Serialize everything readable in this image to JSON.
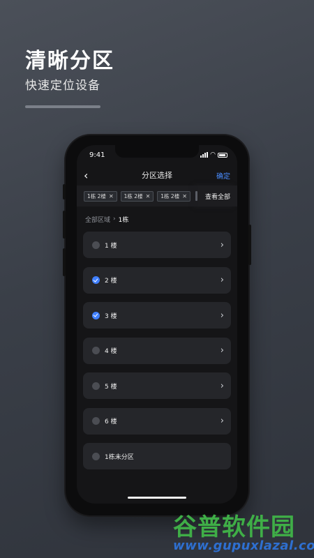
{
  "promo": {
    "title": "清晰分区",
    "subtitle": "快速定位设备"
  },
  "status_bar": {
    "time": "9:41"
  },
  "nav": {
    "title": "分区选择",
    "confirm_label": "确定"
  },
  "selected_tags": [
    {
      "label": "1栋 2楼"
    },
    {
      "label": "1栋 2楼"
    },
    {
      "label": "1栋 2楼"
    }
  ],
  "view_all_label": "查看全部",
  "breadcrumb": {
    "root": "全部区域",
    "current": "1栋"
  },
  "floors": [
    {
      "label": "1 楼",
      "checked": false,
      "has_children": true
    },
    {
      "label": "2 楼",
      "checked": true,
      "has_children": true
    },
    {
      "label": "3 楼",
      "checked": true,
      "has_children": true
    },
    {
      "label": "4 楼",
      "checked": false,
      "has_children": true
    },
    {
      "label": "5 楼",
      "checked": false,
      "has_children": true
    },
    {
      "label": "6 楼",
      "checked": false,
      "has_children": true
    },
    {
      "label": "1栋未分区",
      "checked": false,
      "has_children": false
    }
  ],
  "watermark": {
    "text": "谷普软件园",
    "url": "www.gupuxlazal.com"
  },
  "colors": {
    "accent": "#3f7fff",
    "confirm": "#4a8dff",
    "watermark_green": "#3fae47",
    "watermark_blue": "#2e6fd0"
  },
  "icons": {
    "back": "chevron-left-icon",
    "chevron": "chevron-right-icon",
    "tag_close": "close-icon",
    "check": "check-icon"
  }
}
